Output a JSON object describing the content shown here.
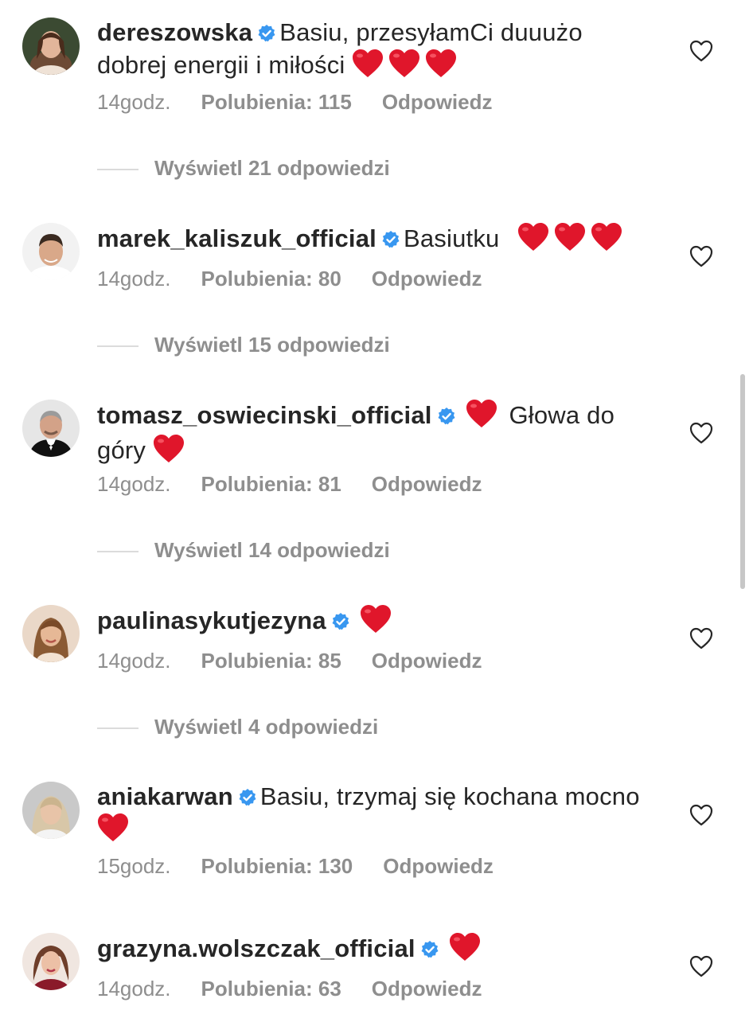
{
  "accent": {
    "verified": "#3897f0",
    "heart": "#e0162b",
    "meta_gray": "#8e8e8e"
  },
  "comments": [
    {
      "username": "dereszowska",
      "text": "Basiu, przesyłamCi duuużo dobrej energii i miłości",
      "emoji": [
        "heart",
        "heart",
        "heart"
      ],
      "time": "14godz.",
      "likes": "Polubienia: 115",
      "reply": "Odpowiedz",
      "replies": "Wyświetl 21 odpowiedzi",
      "verified": true,
      "avatar_icon": "avatar-woman-dark-hair"
    },
    {
      "username": "marek_kaliszuk_official",
      "text": "Basiutku",
      "emoji": [
        "heart",
        "heart",
        "heart"
      ],
      "time": "14godz.",
      "likes": "Polubienia: 80",
      "reply": "Odpowiedz",
      "replies": "Wyświetl 15 odpowiedzi",
      "verified": true,
      "avatar_icon": "avatar-man-short-hair"
    },
    {
      "username": "tomasz_oswiecinski_official",
      "text_before": "",
      "text": "Głowa do góry",
      "emoji_before": [
        "heart"
      ],
      "emoji": [
        "heart"
      ],
      "time": "14godz.",
      "likes": "Polubienia: 81",
      "reply": "Odpowiedz",
      "replies": "Wyświetl 14 odpowiedzi",
      "verified": true,
      "avatar_icon": "avatar-man-bowtie"
    },
    {
      "username": "paulinasykutjezyna",
      "text": "",
      "emoji": [
        "heart"
      ],
      "time": "14godz.",
      "likes": "Polubienia: 85",
      "reply": "Odpowiedz",
      "replies": "Wyświetl 4 odpowiedzi",
      "verified": true,
      "avatar_icon": "avatar-woman-brown-hair"
    },
    {
      "username": "aniakarwan",
      "text": "Basiu, trzymaj się kochana mocno",
      "emoji": [
        "heart"
      ],
      "time": "15godz.",
      "likes": "Polubienia: 130",
      "reply": "Odpowiedz",
      "verified": true,
      "avatar_icon": "avatar-woman-blonde"
    },
    {
      "username": "grazyna.wolszczak_official",
      "text": "",
      "emoji": [
        "heart"
      ],
      "time": "14godz.",
      "likes": "Polubienia: 63",
      "reply": "Odpowiedz",
      "verified": true,
      "avatar_icon": "avatar-woman-bob"
    }
  ]
}
